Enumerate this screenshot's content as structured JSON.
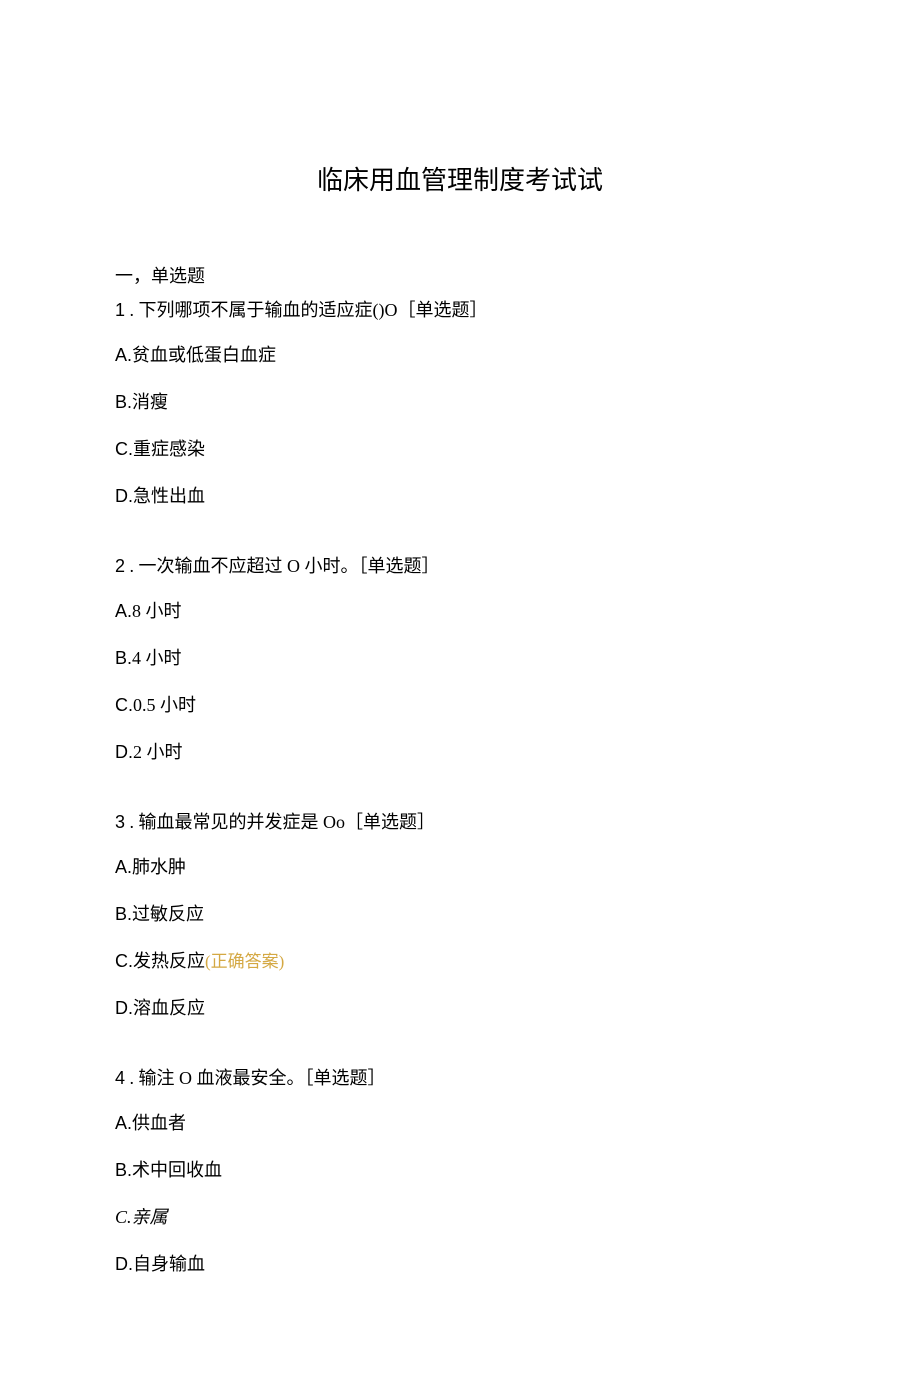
{
  "title": "临床用血管理制度考试试",
  "section_header": "一，单选题",
  "questions": [
    {
      "number": "1",
      "text": " . 下列哪项不属于输血的适应症()O［单选题］",
      "options": [
        {
          "label": "A.",
          "text": "贫血或低蛋白血症"
        },
        {
          "label": "B.",
          "text": "消瘦"
        },
        {
          "label": "C.",
          "text": "重症感染"
        },
        {
          "label": "D.",
          "text": "急性出血"
        }
      ]
    },
    {
      "number": "2",
      "text": "  . 一次输血不应超过 O 小时。［单选题］",
      "options": [
        {
          "label": "A.",
          "text": "8 小时"
        },
        {
          "label": "B.",
          "text": "4 小时"
        },
        {
          "label": "C.",
          "text": "0.5 小时"
        },
        {
          "label": "D.",
          "text": "2 小时"
        }
      ]
    },
    {
      "number": "3",
      "text": "  . 输血最常见的并发症是 Oo［单选题］",
      "options": [
        {
          "label": "A.",
          "text": "肺水肿"
        },
        {
          "label": "B.",
          "text": "过敏反应"
        },
        {
          "label": "C.",
          "text": "发热反应",
          "correct": "(正确答案)"
        },
        {
          "label": "D.",
          "text": "溶血反应"
        }
      ]
    },
    {
      "number": "4",
      "text": "  . 输注 O 血液最安全。［单选题］",
      "options": [
        {
          "label": "A.",
          "text": "供血者"
        },
        {
          "label": "B.",
          "text": "术中回收血"
        },
        {
          "label": "C.",
          "text": "亲属",
          "italic": true
        },
        {
          "label": "D.",
          "text": "自身输血"
        }
      ]
    }
  ]
}
